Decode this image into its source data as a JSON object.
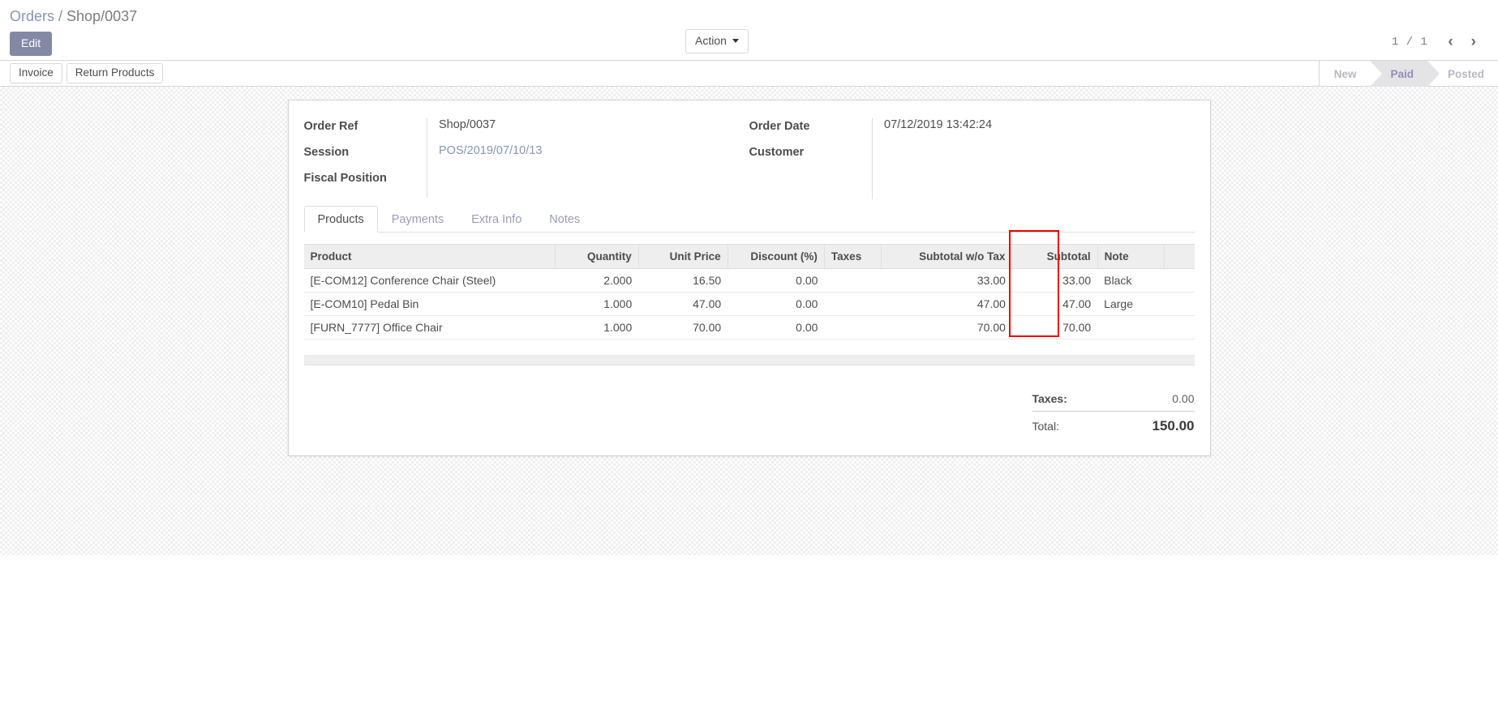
{
  "breadcrumb": {
    "root": "Orders",
    "separator": "/",
    "current": "Shop/0037"
  },
  "toolbar": {
    "edit_label": "Edit",
    "action_label": "Action",
    "invoice_label": "Invoice",
    "return_products_label": "Return Products"
  },
  "pager": {
    "count": "1 / 1",
    "prev_glyph": "‹",
    "next_glyph": "›"
  },
  "statusbar": {
    "states": [
      {
        "label": "New",
        "active": false
      },
      {
        "label": "Paid",
        "active": true
      },
      {
        "label": "Posted",
        "active": false
      }
    ]
  },
  "form": {
    "left_fields": [
      {
        "label": "Order Ref",
        "value": "Shop/0037",
        "is_link": false
      },
      {
        "label": "Session",
        "value": "POS/2019/07/10/13",
        "is_link": true
      },
      {
        "label": "Fiscal Position",
        "value": "",
        "is_link": false
      }
    ],
    "right_fields": [
      {
        "label": "Order Date",
        "value": "07/12/2019 13:42:24",
        "is_link": false
      },
      {
        "label": "Customer",
        "value": "",
        "is_link": false
      }
    ]
  },
  "notebook": {
    "tabs": [
      {
        "label": "Products",
        "active": true
      },
      {
        "label": "Payments",
        "active": false
      },
      {
        "label": "Extra Info",
        "active": false
      },
      {
        "label": "Notes",
        "active": false
      }
    ]
  },
  "lines_table": {
    "columns": [
      "Product",
      "Quantity",
      "Unit Price",
      "Discount (%)",
      "Taxes",
      "Subtotal w/o Tax",
      "Subtotal",
      "Note"
    ],
    "rows": [
      {
        "product": "[E-COM12] Conference Chair (Steel)",
        "quantity": "2.000",
        "unit_price": "16.50",
        "discount": "0.00",
        "taxes": "",
        "subtotal_wo_tax": "33.00",
        "subtotal": "33.00",
        "note": "Black"
      },
      {
        "product": "[E-COM10] Pedal Bin",
        "quantity": "1.000",
        "unit_price": "47.00",
        "discount": "0.00",
        "taxes": "",
        "subtotal_wo_tax": "47.00",
        "subtotal": "47.00",
        "note": "Large"
      },
      {
        "product": "[FURN_7777] Office Chair",
        "quantity": "1.000",
        "unit_price": "70.00",
        "discount": "0.00",
        "taxes": "",
        "subtotal_wo_tax": "70.00",
        "subtotal": "70.00",
        "note": ""
      }
    ]
  },
  "totals": {
    "taxes_label": "Taxes:",
    "taxes_value": "0.00",
    "total_label": "Total:",
    "total_value": "150.00"
  },
  "annotation": {
    "highlight_color": "#ee0000",
    "highlight_target": "Note column"
  }
}
